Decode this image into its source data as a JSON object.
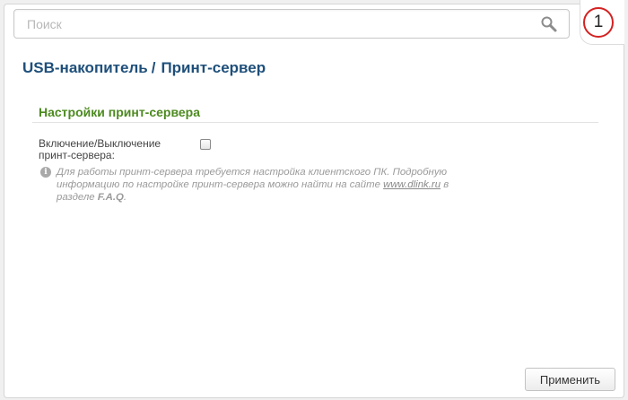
{
  "search": {
    "placeholder": "Поиск",
    "value": ""
  },
  "notifications": {
    "count": "1"
  },
  "breadcrumb": {
    "items": [
      "USB-накопитель",
      "Принт-сервер"
    ],
    "separator": "/"
  },
  "section": {
    "title": "Настройки принт-сервера",
    "toggle_label": "Включение/Выключение принт-сервера:",
    "toggle_checked": false,
    "info": {
      "text_part1": "Для работы принт-сервера требуется настройка клиентского ПК. Подробную информацию по настройке принт-сервера можно найти на сайте ",
      "link": "www.dlink.ru",
      "text_part2": " в разделе ",
      "faq": "F.A.Q",
      "text_part3": "."
    }
  },
  "actions": {
    "apply_label": "Применить"
  },
  "colors": {
    "title_blue": "#1e4f7a",
    "section_green": "#4c8a1f",
    "badge_red": "#d42222"
  }
}
